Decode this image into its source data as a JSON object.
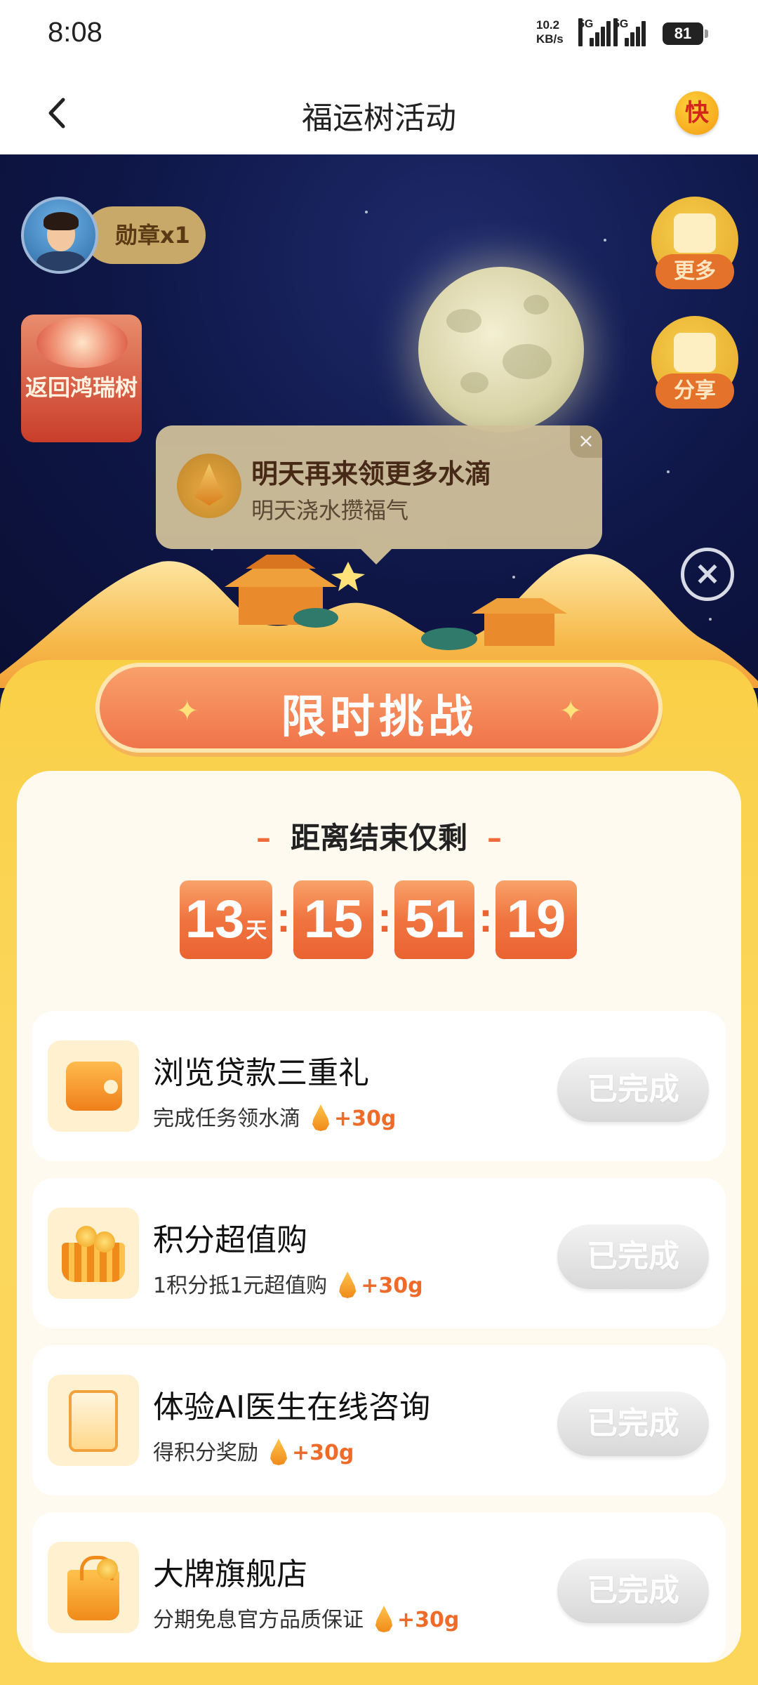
{
  "status_bar": {
    "time": "8:08",
    "net_speed": "10.2",
    "net_unit": "KB/s",
    "signal_1": "5G",
    "signal_2": "5G",
    "battery": "81"
  },
  "header": {
    "title": "福运树活动",
    "kuai_label": "快"
  },
  "scene": {
    "medal_label": "勋章x1",
    "tree_button_label": "返回鸿瑞树",
    "more_label": "更多",
    "share_label": "分享",
    "tooltip_title": "明天再来领更多水滴",
    "tooltip_subtitle": "明天浇水攒福气",
    "tooltip_close": "×",
    "close_label": "×"
  },
  "challenge": {
    "banner_title": "限时挑战",
    "countdown_label": "距离结束仅剩",
    "countdown": {
      "days": "13",
      "days_unit": "天",
      "hours": "15",
      "minutes": "51",
      "seconds": "19"
    }
  },
  "tasks": [
    {
      "name": "浏览贷款三重礼",
      "desc": "完成任务领水滴",
      "reward": "+30g",
      "status": "已完成",
      "icon": "wallet-icon"
    },
    {
      "name": "积分超值购",
      "desc": "1积分抵1元超值购",
      "reward": "+30g",
      "status": "已完成",
      "icon": "basket-icon"
    },
    {
      "name": "体验AI医生在线咨询",
      "desc": "得积分奖励",
      "reward": "+30g",
      "status": "已完成",
      "icon": "medical-clipboard-icon"
    },
    {
      "name": "大牌旗舰店",
      "desc": "分期免息官方品质保证",
      "reward": "+30g",
      "status": "已完成",
      "icon": "shopping-bag-icon"
    }
  ],
  "colors": {
    "accent_orange": "#f0743f",
    "panel_yellow": "#f9cf46",
    "night_blue": "#0e1646"
  }
}
